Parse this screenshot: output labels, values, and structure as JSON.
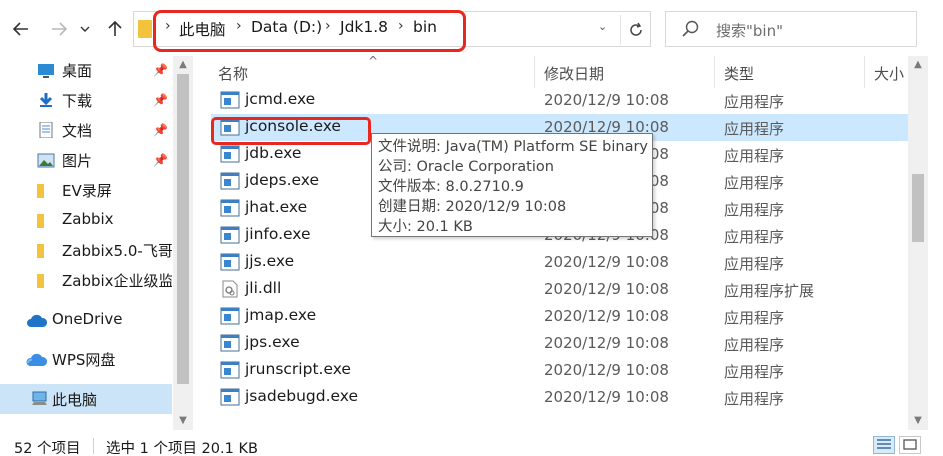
{
  "address": {
    "crumbs": [
      "此电脑",
      "Data (D:)",
      "Jdk1.8",
      "bin"
    ],
    "search_placeholder": "搜索\"bin\""
  },
  "nav": {
    "items": [
      {
        "label": "桌面",
        "icon": "desktop-icon",
        "pinned": true
      },
      {
        "label": "下载",
        "icon": "download-icon",
        "pinned": true
      },
      {
        "label": "文档",
        "icon": "document-icon",
        "pinned": true
      },
      {
        "label": "图片",
        "icon": "picture-icon",
        "pinned": true
      },
      {
        "label": "EV录屏",
        "icon": "folder-icon",
        "pinned": false
      },
      {
        "label": "Zabbix",
        "icon": "folder-icon",
        "pinned": false
      },
      {
        "label": "Zabbix5.0-飞哥",
        "icon": "folder-icon",
        "pinned": false
      },
      {
        "label": "Zabbix企业级监",
        "icon": "folder-icon",
        "pinned": false
      },
      {
        "label": "OneDrive",
        "icon": "cloud-icon",
        "pinned": false
      },
      {
        "label": "WPS网盘",
        "icon": "wps-cloud-icon",
        "pinned": false
      },
      {
        "label": "此电脑",
        "icon": "computer-icon",
        "pinned": false
      }
    ]
  },
  "columns": {
    "name": "名称",
    "date": "修改日期",
    "type": "类型",
    "size": "大小"
  },
  "files": [
    {
      "name": "jcmd.exe",
      "date": "2020/12/9 10:08",
      "type": "应用程序",
      "icon": "exe-icon"
    },
    {
      "name": "jconsole.exe",
      "date": "2020/12/9 10:08",
      "type": "应用程序",
      "icon": "exe-icon"
    },
    {
      "name": "jdb.exe",
      "date": "2020/12/9 10:08",
      "type": "应用程序",
      "icon": "exe-icon"
    },
    {
      "name": "jdeps.exe",
      "date": "2020/12/9 10:08",
      "type": "应用程序",
      "icon": "exe-icon"
    },
    {
      "name": "jhat.exe",
      "date": "2020/12/9 10:08",
      "type": "应用程序",
      "icon": "exe-icon"
    },
    {
      "name": "jinfo.exe",
      "date": "2020/12/9 10:08",
      "type": "应用程序",
      "icon": "exe-icon"
    },
    {
      "name": "jjs.exe",
      "date": "2020/12/9 10:08",
      "type": "应用程序",
      "icon": "exe-icon"
    },
    {
      "name": "jli.dll",
      "date": "2020/12/9 10:08",
      "type": "应用程序扩展",
      "icon": "dll-icon"
    },
    {
      "name": "jmap.exe",
      "date": "2020/12/9 10:08",
      "type": "应用程序",
      "icon": "exe-icon"
    },
    {
      "name": "jps.exe",
      "date": "2020/12/9 10:08",
      "type": "应用程序",
      "icon": "exe-icon"
    },
    {
      "name": "jrunscript.exe",
      "date": "2020/12/9 10:08",
      "type": "应用程序",
      "icon": "exe-icon"
    },
    {
      "name": "jsadebugd.exe",
      "date": "2020/12/9 10:08",
      "type": "应用程序",
      "icon": "exe-icon"
    }
  ],
  "tooltip": {
    "lines": [
      "文件说明: Java(TM) Platform SE binary",
      "公司: Oracle Corporation",
      "文件版本: 8.0.2710.9",
      "创建日期: 2020/12/9 10:08",
      "大小: 20.1 KB"
    ]
  },
  "status": {
    "count": "52 个项目",
    "selected": "选中 1 个项目  20.1 KB"
  },
  "colors": {
    "selection": "#cce8ff",
    "nav_selection": "#cce4f7",
    "annotation_red": "#e8281e",
    "folder_yellow": "#f3c33d"
  }
}
